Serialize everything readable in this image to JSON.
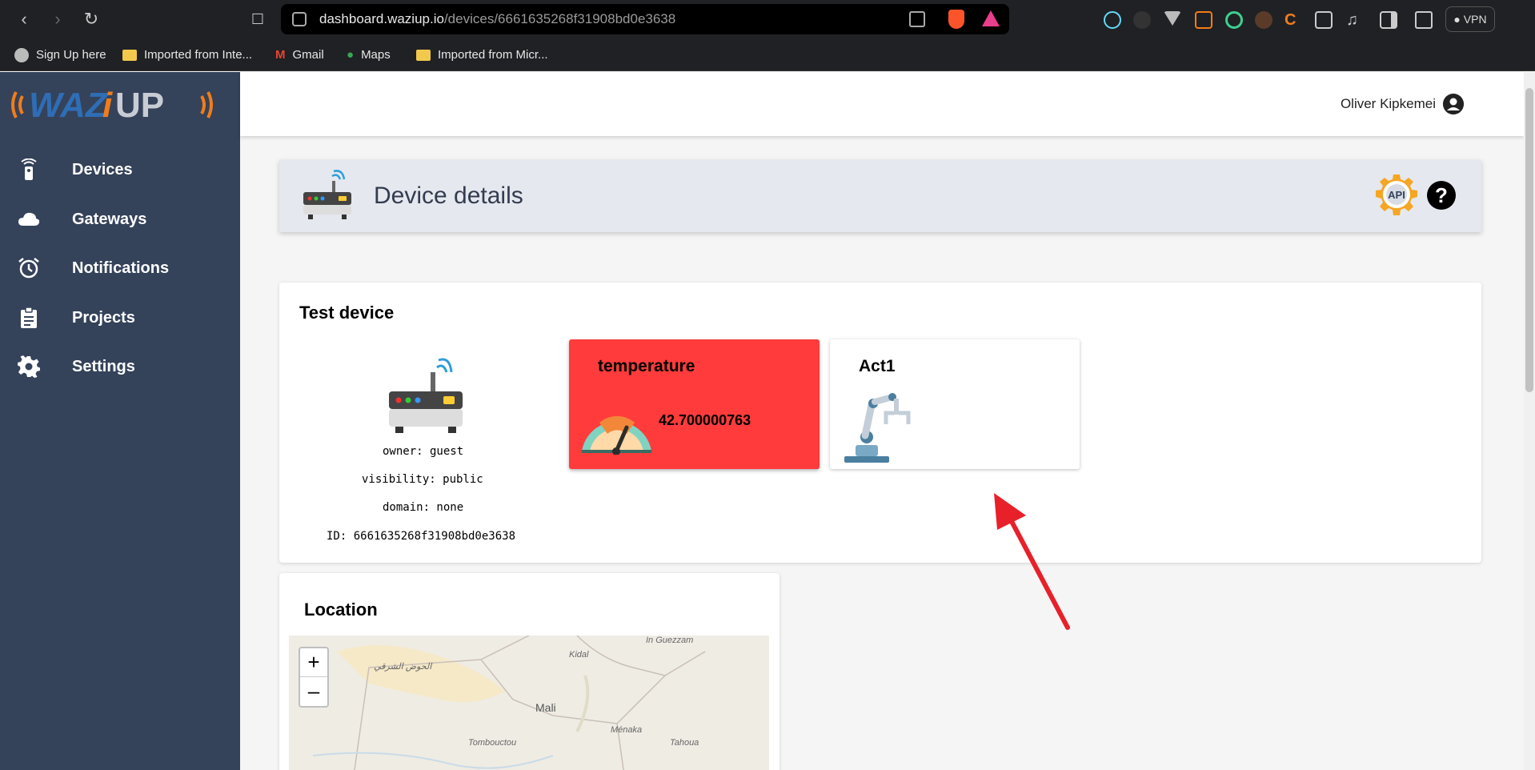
{
  "browser": {
    "url_domain": "dashboard.waziup.io",
    "url_path": "/devices/6661635268f31908bd0e3638",
    "vpn_label": "VPN",
    "bookmarks": [
      {
        "label": "Sign Up here"
      },
      {
        "label": "Imported from Inte..."
      },
      {
        "label": "Gmail"
      },
      {
        "label": "Maps"
      },
      {
        "label": "Imported from Micr..."
      }
    ]
  },
  "sidebar": {
    "items": [
      {
        "label": "Devices",
        "icon": "remote-icon"
      },
      {
        "label": "Gateways",
        "icon": "cloud-icon"
      },
      {
        "label": "Notifications",
        "icon": "alarm-clock-icon"
      },
      {
        "label": "Projects",
        "icon": "clipboard-icon"
      },
      {
        "label": "Settings",
        "icon": "gear-icon"
      }
    ]
  },
  "header": {
    "username": "Oliver Kipkemei"
  },
  "page": {
    "title": "Device details",
    "help_symbol": "?",
    "api_label": "API"
  },
  "device": {
    "name": "Test device",
    "owner": "owner: guest",
    "visibility": "visibility: public",
    "domain": "domain: none",
    "id": "ID: 6661635268f31908bd0e3638"
  },
  "sensor": {
    "name": "temperature",
    "value": "42.700000763",
    "color": "#ff3b3b"
  },
  "actuator": {
    "name": "Act1"
  },
  "location": {
    "title": "Location",
    "zoom_in": "+",
    "zoom_out": "–",
    "map_labels": {
      "region1": "الحوض الشرقي",
      "kidal": "Kidal",
      "ingezzam": "In Guezzam",
      "country": "Mali",
      "menaka": "Ménaka",
      "tombouctou": "Tombouctou",
      "tahoua": "Tahoua"
    }
  },
  "colors": {
    "sidebar_bg": "#34425a",
    "accent_orange": "#f07d1a",
    "accent_blue": "#2f6db5",
    "annotation_red": "#e8202a"
  }
}
